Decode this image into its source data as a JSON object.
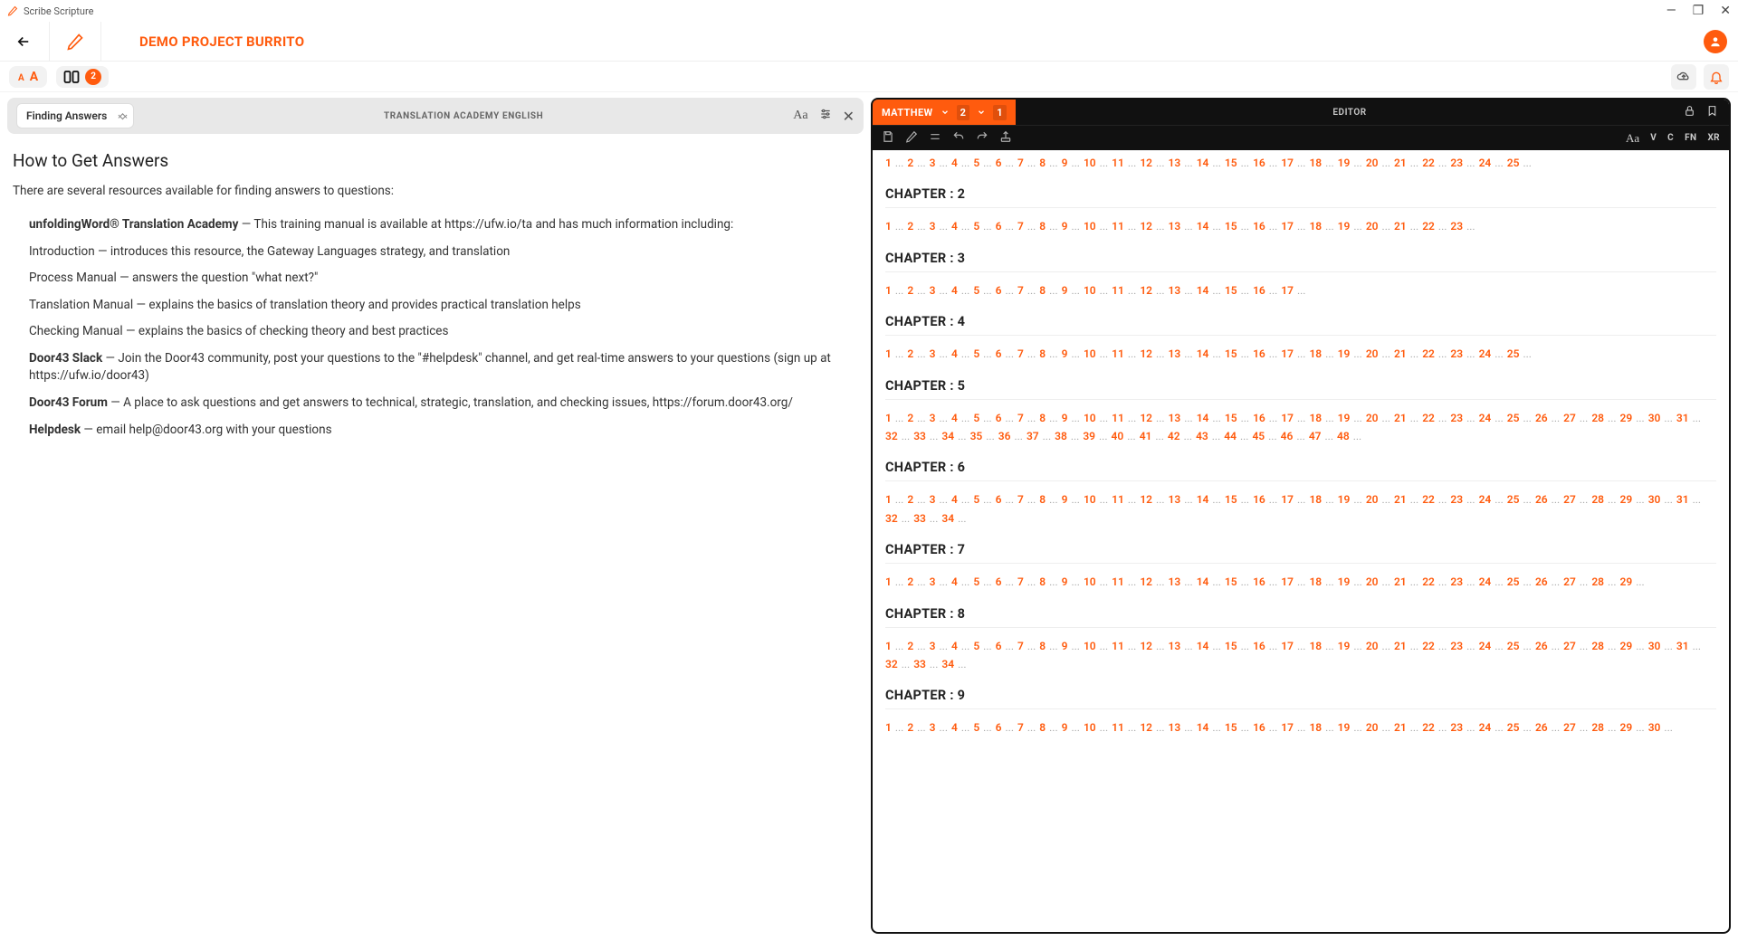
{
  "window": {
    "app_name": "Scribe Scripture"
  },
  "project": {
    "title": "DEMO PROJECT BURRITO"
  },
  "toolbar": {
    "layout_badge": "2"
  },
  "left": {
    "dropdown_value": "Finding Answers",
    "header_title": "TRANSLATION ACADEMY ENGLISH",
    "heading": "How to Get Answers",
    "intro": "There are several resources available for finding answers to questions:",
    "items": [
      {
        "bold": "unfoldingWord® Translation Academy",
        "rest": " — This training manual is available at https://ufw.io/ta and has much information including:"
      },
      {
        "bold": "",
        "rest": "Introduction — introduces this resource, the Gateway Languages strategy, and translation"
      },
      {
        "bold": "",
        "rest": "Process Manual — answers the question \"what next?\""
      },
      {
        "bold": "",
        "rest": "Translation Manual — explains the basics of translation theory and provides practical translation helps"
      },
      {
        "bold": "",
        "rest": "Checking Manual — explains the basics of checking theory and best practices"
      },
      {
        "bold": "Door43 Slack",
        "rest": " — Join the Door43 community, post your questions to the \"#helpdesk\" channel, and get real-time answers to your questions (sign up at https://ufw.io/door43)"
      },
      {
        "bold": "Door43 Forum",
        "rest": " — A place to ask questions and get answers to technical, strategic, translation, and checking issues, https://forum.door43.org/"
      },
      {
        "bold": "Helpdesk",
        "rest": " — email help@door43.org with your questions"
      }
    ]
  },
  "right": {
    "book": "MATTHEW",
    "chapter_sel": "2",
    "verse_sel": "1",
    "editor_label": "EDITOR",
    "tokens": [
      "V",
      "C",
      "FN",
      "XR"
    ],
    "chapter_label_prefix": "CHAPTER : ",
    "chapters": [
      {
        "n": 1,
        "verses": 25,
        "hide_heading": true
      },
      {
        "n": 2,
        "verses": 23
      },
      {
        "n": 3,
        "verses": 17
      },
      {
        "n": 4,
        "verses": 25
      },
      {
        "n": 5,
        "verses": 48
      },
      {
        "n": 6,
        "verses": 34
      },
      {
        "n": 7,
        "verses": 29
      },
      {
        "n": 8,
        "verses": 34
      },
      {
        "n": 9,
        "verses": 30
      }
    ]
  }
}
